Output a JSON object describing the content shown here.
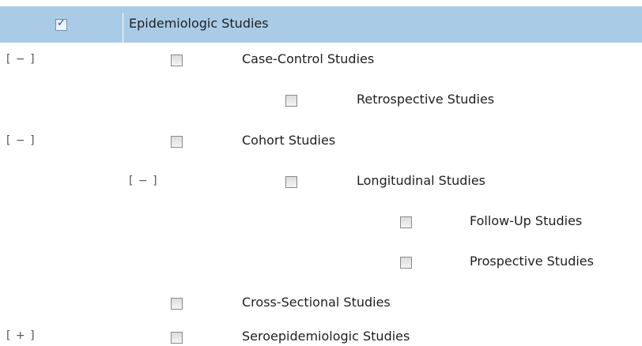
{
  "tree": {
    "root": {
      "label": "Epidemiologic Studies",
      "checked": true
    },
    "items": [
      {
        "toggle": "[ − ]",
        "label": "Case-Control Studies"
      },
      {
        "toggle": "",
        "label": "Retrospective Studies"
      },
      {
        "toggle": "[ − ]",
        "label": "Cohort Studies"
      },
      {
        "toggle": "[ − ]",
        "label": "Longitudinal Studies"
      },
      {
        "toggle": "",
        "label": "Follow-Up Studies"
      },
      {
        "toggle": "",
        "label": "Prospective Studies"
      },
      {
        "toggle": "",
        "label": "Cross-Sectional Studies"
      },
      {
        "toggle": "[ + ]",
        "label": "Seroepidemiologic Studies"
      }
    ]
  },
  "colors": {
    "highlight": "#aacbe6",
    "text": "#1f1f1f",
    "toggle": "#555555",
    "check": "#2b4f8a"
  }
}
